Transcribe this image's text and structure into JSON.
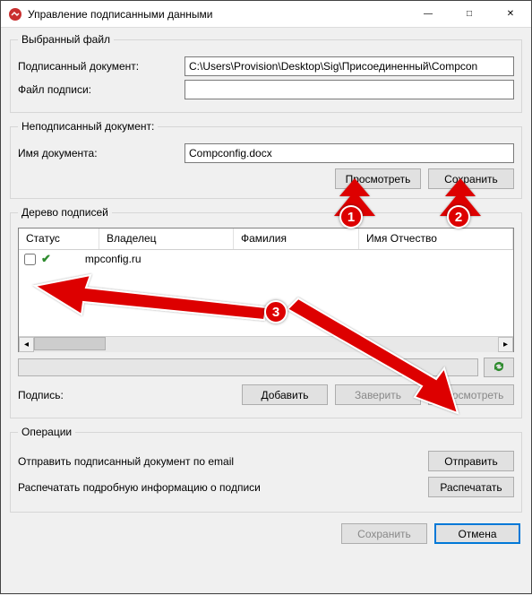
{
  "window": {
    "title": "Управление подписанными данными"
  },
  "selected_file": {
    "legend": "Выбранный файл",
    "signed_doc_label": "Подписанный документ:",
    "signed_doc_value": "C:\\Users\\Provision\\Desktop\\Sig\\Присоединенный\\Compcon",
    "sig_file_label": "Файл подписи:",
    "sig_file_value": ""
  },
  "unsigned_doc": {
    "legend": "Неподписанный документ:",
    "name_label": "Имя документа:",
    "name_value": "Compconfig.docx",
    "view_btn": "Просмотреть",
    "save_btn": "Сохранить"
  },
  "tree": {
    "legend": "Дерево подписей",
    "columns": {
      "status": "Статус",
      "owner": "Владелец",
      "surname": "Фамилия",
      "given": "Имя Отчество"
    },
    "row0_text": "mpconfig.ru"
  },
  "signature_section": {
    "label": "Подпись:",
    "add_btn": "Добавить",
    "certify_btn": "Заверить",
    "view_btn": "Просмотреть"
  },
  "operations": {
    "legend": "Операции",
    "email_label": "Отправить подписанный документ по email",
    "email_btn": "Отправить",
    "print_label": "Распечатать подробную информацию о подписи",
    "print_btn": "Распечатать"
  },
  "bottom": {
    "save": "Сохранить",
    "cancel": "Отмена"
  },
  "annotations": {
    "one": "1",
    "two": "2",
    "three": "3"
  }
}
